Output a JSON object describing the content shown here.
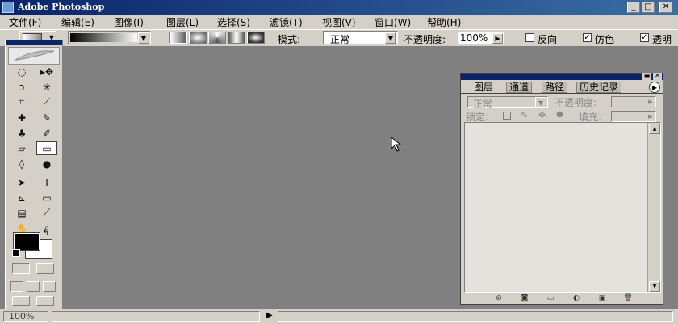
{
  "app": {
    "title": "Adobe Photoshop"
  },
  "window_buttons": {
    "minimize": "_",
    "maximize": "□",
    "close": "✕"
  },
  "menu": [
    {
      "label": "文件(F)"
    },
    {
      "label": "编辑(E)"
    },
    {
      "label": "图像(I)"
    },
    {
      "label": "图层(L)"
    },
    {
      "label": "选择(S)"
    },
    {
      "label": "滤镜(T)"
    },
    {
      "label": "视图(V)"
    },
    {
      "label": "窗口(W)"
    },
    {
      "label": "帮助(H)"
    }
  ],
  "options": {
    "mode_label": "模式:",
    "mode_value": "正常",
    "opacity_label": "不透明度:",
    "opacity_value": "100%",
    "reverse_label": "反向",
    "reverse_checked": false,
    "dither_label": "仿色",
    "dither_checked": true,
    "transparency_label": "透明",
    "transparency_checked": true,
    "gradient_type_icons": [
      "linear-gradient-icon",
      "radial-gradient-icon",
      "angle-gradient-icon",
      "reflected-gradient-icon",
      "diamond-gradient-icon"
    ]
  },
  "toolbox": {
    "tools": [
      {
        "name": "marquee-tool",
        "glyph": "◌"
      },
      {
        "name": "move-tool",
        "glyph": "▸✥"
      },
      {
        "name": "lasso-tool",
        "glyph": "ↄ"
      },
      {
        "name": "magic-wand-tool",
        "glyph": "✳"
      },
      {
        "name": "crop-tool",
        "glyph": "⌗"
      },
      {
        "name": "slice-tool",
        "glyph": "⟋"
      },
      {
        "name": "healing-brush-tool",
        "glyph": "✚"
      },
      {
        "name": "brush-tool",
        "glyph": "✎"
      },
      {
        "name": "clone-stamp-tool",
        "glyph": "♣"
      },
      {
        "name": "history-brush-tool",
        "glyph": "✐"
      },
      {
        "name": "eraser-tool",
        "glyph": "▱"
      },
      {
        "name": "gradient-tool",
        "glyph": "▭"
      },
      {
        "name": "blur-tool",
        "glyph": "◊"
      },
      {
        "name": "dodge-tool",
        "glyph": "●"
      },
      {
        "name": "path-selection-tool",
        "glyph": "➤"
      },
      {
        "name": "type-tool",
        "glyph": "T"
      },
      {
        "name": "pen-tool",
        "glyph": "⊾"
      },
      {
        "name": "shape-tool",
        "glyph": "▭"
      },
      {
        "name": "notes-tool",
        "glyph": "▤"
      },
      {
        "name": "eyedropper-tool",
        "glyph": "⟋"
      },
      {
        "name": "hand-tool",
        "glyph": "✋"
      },
      {
        "name": "zoom-tool",
        "glyph": "⌕"
      }
    ],
    "selected_tool": "gradient-tool",
    "foreground_color": "#000000",
    "background_color": "#ffffff"
  },
  "layers_panel": {
    "tabs": [
      {
        "label": "图层",
        "active": true
      },
      {
        "label": "通道",
        "active": false
      },
      {
        "label": "路径",
        "active": false
      },
      {
        "label": "历史记录",
        "active": false
      }
    ],
    "blend_mode": "正常",
    "opacity_label": "不透明度:",
    "lock_label": "锁定:",
    "fill_label": "填充:"
  },
  "status": {
    "zoom": "100%"
  },
  "colors": {
    "titlebar": "#0a246a",
    "workspace": "#808080",
    "chrome": "#d4d0c8"
  }
}
